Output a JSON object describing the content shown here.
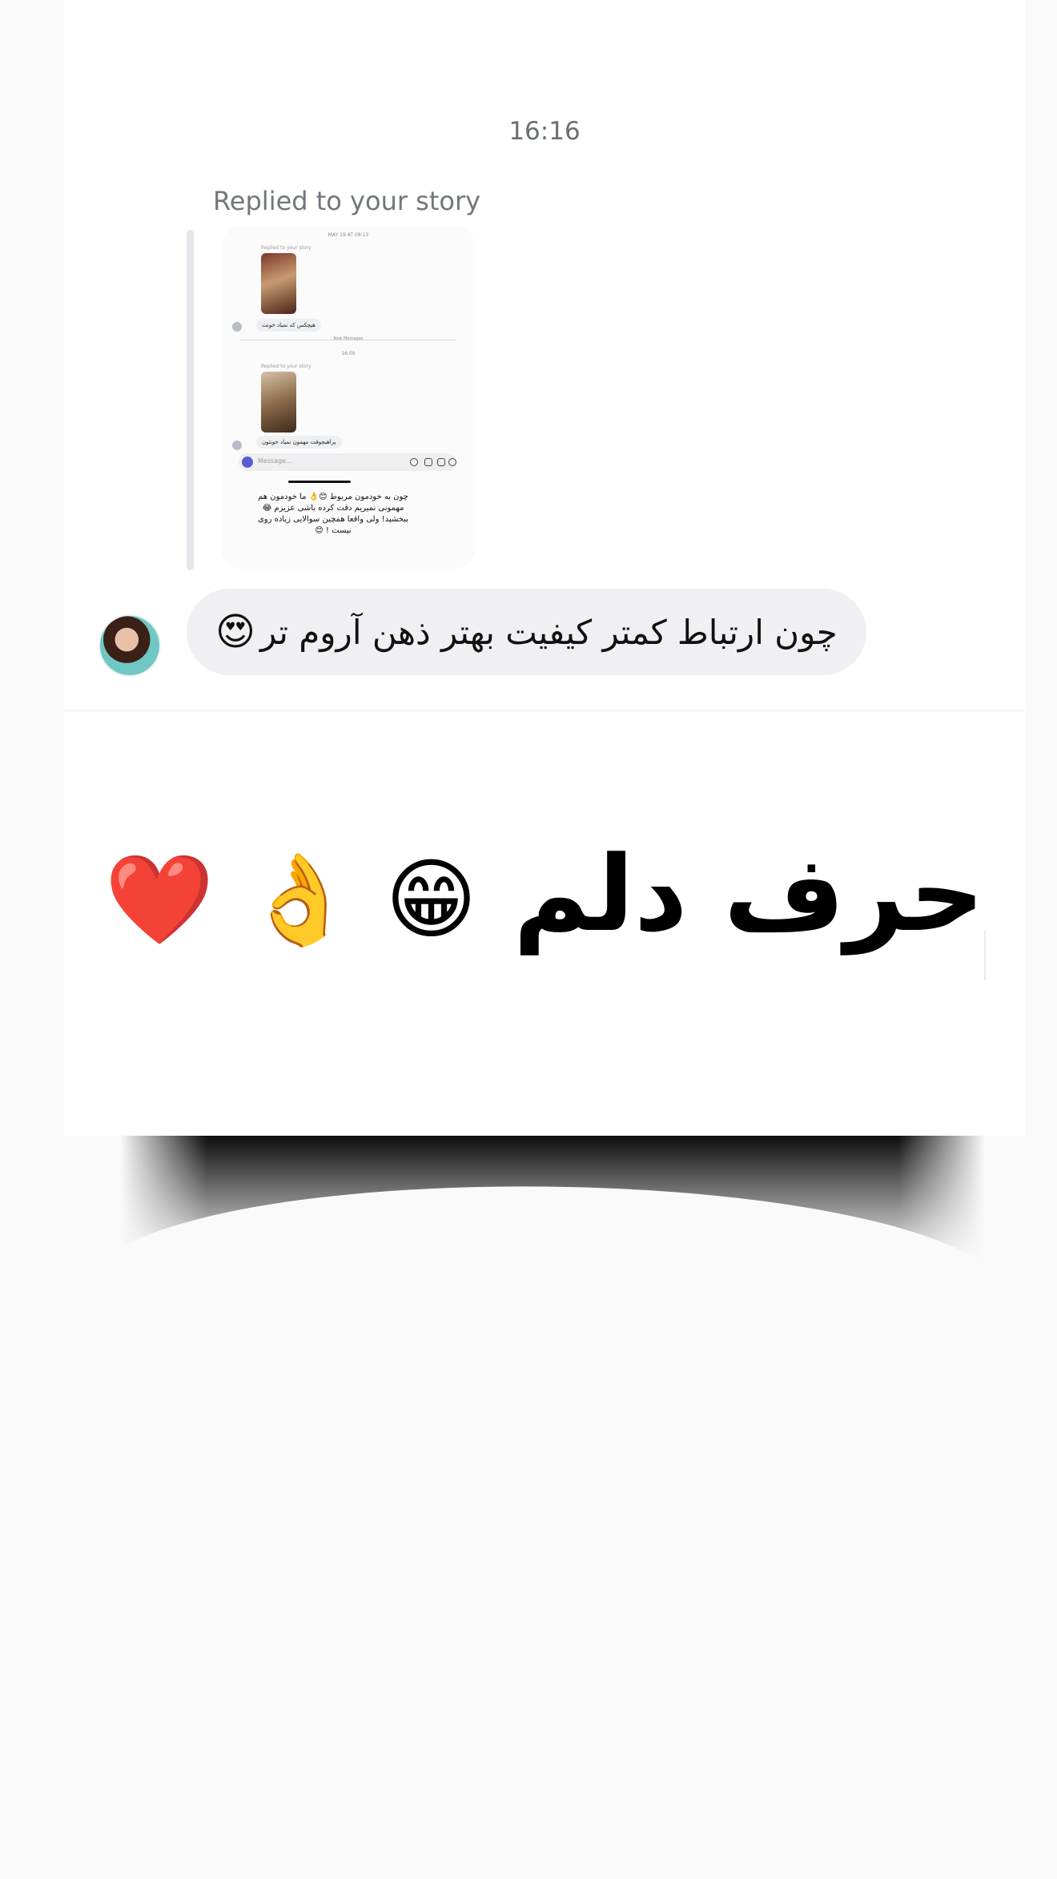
{
  "chat": {
    "timestamp": "16:16",
    "reply_label": "Replied to your story",
    "story_preview": {
      "timestamp_top": "MAY 19 AT 08:13",
      "replied_label_1": "Replied to your story",
      "reply_text_1": "هیچکس که نمیاد خونت",
      "new_messages_label": "New Messages",
      "timestamp_mid": "16:09",
      "replied_label_2": "Replied to your story",
      "reply_text_2": "پراهیچوقت مهمون نمیاد خونتون",
      "input_placeholder": "Message...",
      "caption": "چون به خودمون مربوط 😊👌 ما خودمون هم مهمونی نمیریم دقت کرده باشی عزیزم 😂ببخشید! ولی واقعا همچین سوالایی زیاده روی نیست ! 😊"
    },
    "message": {
      "text": "چون ارتباط کمتر کیفیت بهتر ذهن آروم تر",
      "emoji": "😍"
    }
  },
  "banner": {
    "text": "حرف دلم",
    "emojis": "😁 👌 ❤️"
  }
}
